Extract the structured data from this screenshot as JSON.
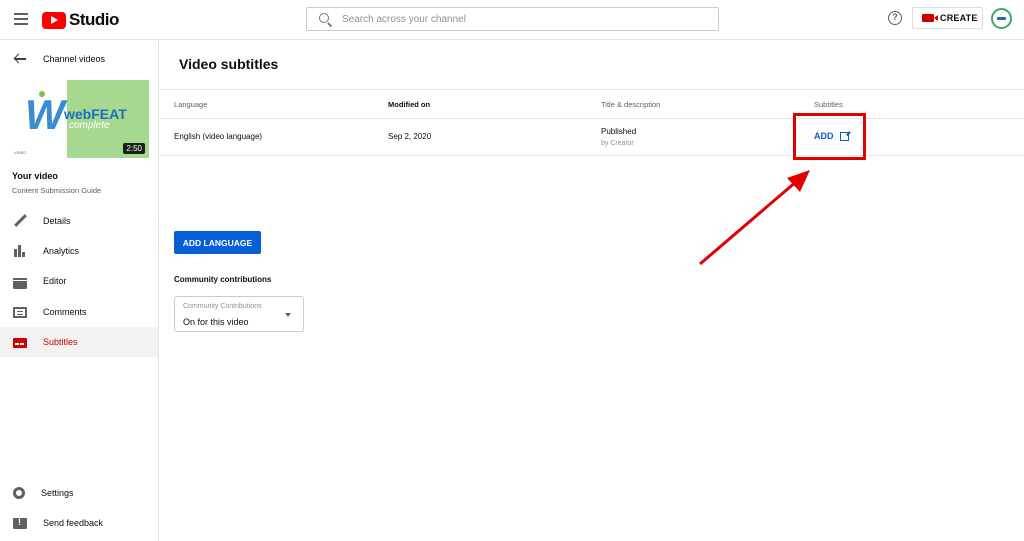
{
  "topbar": {
    "logo_text": "Studio",
    "search_placeholder": "Search across your channel",
    "help_symbol": "?",
    "create_label": "CREATE"
  },
  "sidebar": {
    "back_label": "Channel videos",
    "thumbnail": {
      "brand_web": "webFEAT",
      "brand_complete": "complete",
      "small_text": "VIDEO",
      "duration": "2:50"
    },
    "your_video_label": "Your video",
    "video_title": "Content Submission Guide",
    "items": [
      {
        "label": "Details",
        "icon": "pencil-icon",
        "active": false
      },
      {
        "label": "Analytics",
        "icon": "analytics-icon",
        "active": false
      },
      {
        "label": "Editor",
        "icon": "editor-icon",
        "active": false
      },
      {
        "label": "Comments",
        "icon": "comments-icon",
        "active": false
      },
      {
        "label": "Subtitles",
        "icon": "subtitles-icon",
        "active": true
      }
    ],
    "bottom_items": [
      {
        "label": "Settings",
        "icon": "gear-icon"
      },
      {
        "label": "Send feedback",
        "icon": "feedback-icon"
      }
    ]
  },
  "main": {
    "title": "Video subtitles",
    "table": {
      "headers": [
        "Language",
        "Modified on",
        "Title & description",
        "Subtitles"
      ],
      "rows": [
        {
          "language": "English (video language)",
          "modified": "Sep 2, 2020",
          "title_status": "Published",
          "title_by": "by Creator",
          "subtitles_action": "ADD"
        }
      ]
    },
    "add_language_label": "ADD LANGUAGE",
    "community_heading": "Community contributions",
    "community_select": {
      "label": "Community Contributions",
      "value": "On for this video"
    }
  },
  "colors": {
    "accent_blue": "#065fd4",
    "brand_red": "#ff0000",
    "annotation_red": "#e00000",
    "active_nav": "#cc0000"
  }
}
